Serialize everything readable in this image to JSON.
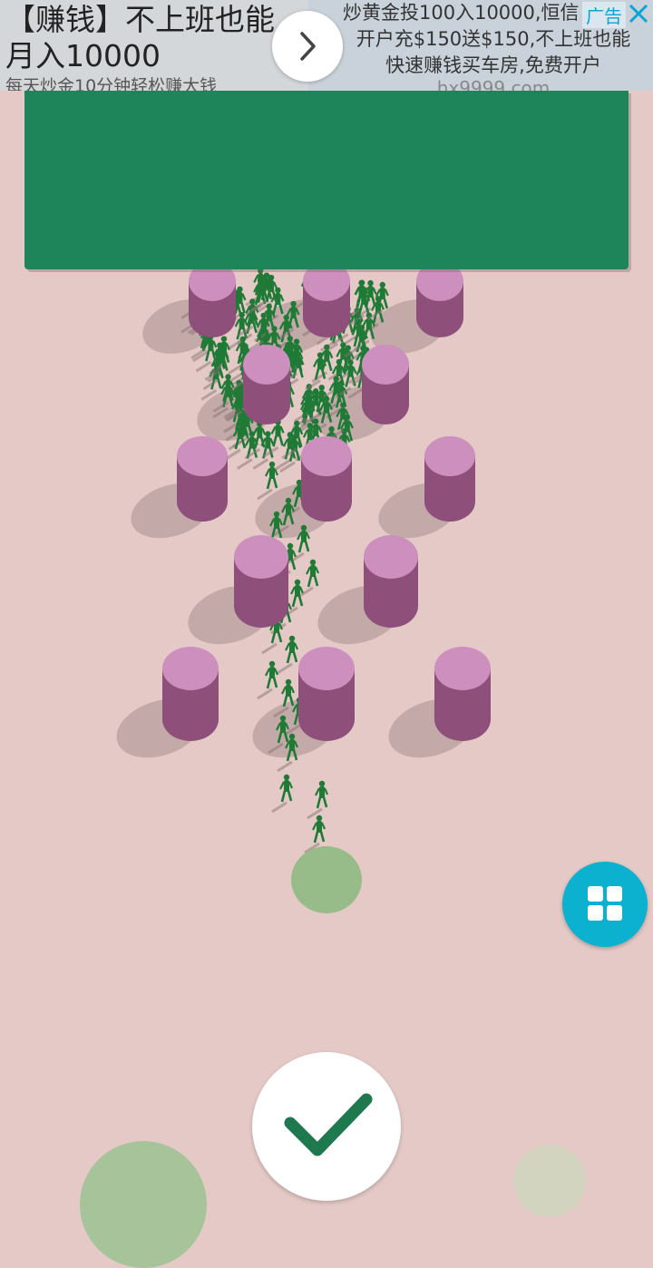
{
  "ad": {
    "headline": "【赚钱】不上班也能月入10000",
    "subline": "每天炒金10分钟轻松赚大钱",
    "body_line1": "炒黄金投100入10000,恒信",
    "body_line2": "开户充$150送$150,不上班也能",
    "body_line3": "快速赚钱买车房,免费开户",
    "domain": "hx9999.com",
    "tag": "广告",
    "arrow_icon": "chevron-right-icon",
    "close_icon": "close-icon"
  },
  "colors": {
    "background": "#e4c9c6",
    "panel": "#1e8459",
    "pillar_top": "#cc8fbe",
    "pillar_side": "#8f4f7b",
    "soldier": "#1f7a36",
    "spawn_marker": "#94bc86",
    "menu_button": "#0cb1cf",
    "confirm_check": "#1e7a4e"
  },
  "controls": {
    "menu_icon": "grid-icon",
    "confirm_icon": "checkmark-icon"
  }
}
